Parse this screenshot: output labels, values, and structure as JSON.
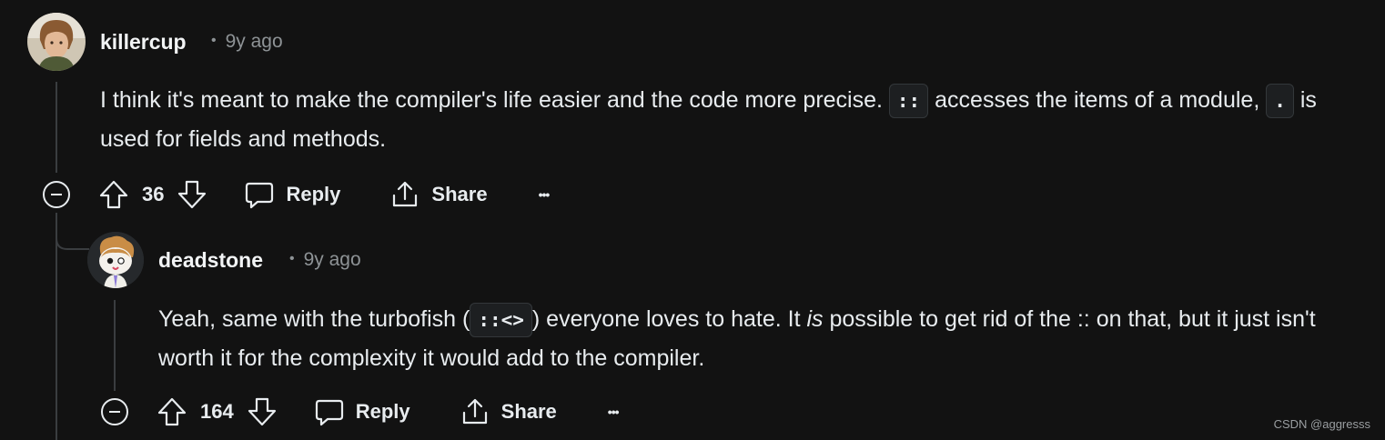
{
  "comments": [
    {
      "username": "killercup",
      "age": "9y ago",
      "text_before_code1": "I think it's meant to make the compiler's life easier and the code more precise. ",
      "code1": "::",
      "text_after_code1": " accesses the items of a module, ",
      "code2": ".",
      "text_after_code2": " is used for fields and methods.",
      "votes": "36",
      "reply_label": "Reply",
      "share_label": "Share",
      "more_label": "•••"
    },
    {
      "username": "deadstone",
      "age": "9y ago",
      "text_before_code1": "Yeah, same with the turbofish (",
      "code1": "::<>",
      "text_after_code1": ") everyone loves to hate. It ",
      "italic": "is",
      "text_after_italic": " possible to get rid of the :: on that, but it just isn't worth it for the complexity it would add to the compiler.",
      "votes": "164",
      "reply_label": "Reply",
      "share_label": "Share",
      "more_label": "•••"
    }
  ],
  "watermark": "CSDN @aggresss",
  "colors": {
    "background": "#121212",
    "text": "#e8ecef",
    "muted": "#8e9396",
    "thread_line": "#3a3d40"
  }
}
